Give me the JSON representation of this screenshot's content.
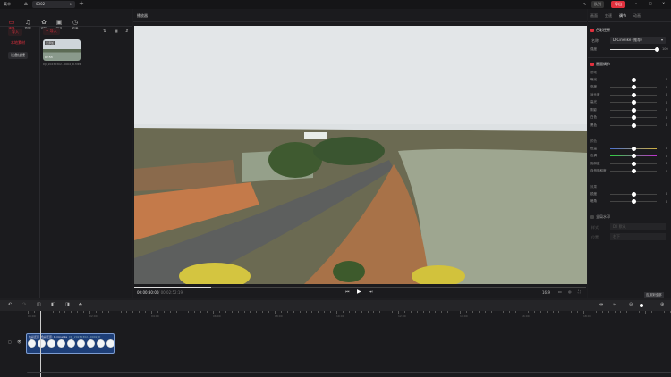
{
  "app": {
    "menu": "菜单",
    "project_tab": "0302",
    "export": "导出",
    "layout": "队列"
  },
  "toolbar": [
    {
      "label": "媒体",
      "icon": "folder-icon",
      "active": true
    },
    {
      "label": "音频",
      "icon": "music-icon"
    },
    {
      "label": "滤镜",
      "icon": "filter-icon"
    },
    {
      "label": "调节",
      "icon": "adjust-icon"
    },
    {
      "label": "效果",
      "icon": "effect-icon"
    }
  ],
  "left": {
    "import": "导入",
    "import_btn": "+ 导入",
    "local": "本地素材",
    "device": "设备连接",
    "media": {
      "badge": "已添加",
      "duration": "02:53",
      "name": "DJI_20230302...0002_D.MP4"
    }
  },
  "player": {
    "title": "播放器",
    "current": "00:00:30:00",
    "total": "/ 00:02:52:19",
    "ratio": "16:9",
    "progress": 0.17
  },
  "right": {
    "tabs": [
      "画面",
      "变速",
      "调节",
      "动画"
    ],
    "active_tab": 2,
    "color": {
      "title": "色彩还原",
      "name_label": "名称",
      "name_value": "D-Cinelike (推荐)",
      "strength_label": "强度",
      "strength": 100
    },
    "adjust": {
      "title": "画面调节",
      "basic_label": "基础",
      "basic": [
        {
          "name": "曝光",
          "v": 0
        },
        {
          "name": "亮度",
          "v": 0
        },
        {
          "name": "对比度",
          "v": 0
        },
        {
          "name": "高光",
          "v": 0
        },
        {
          "name": "阴影",
          "v": 0
        },
        {
          "name": "白色",
          "v": 0
        },
        {
          "name": "黑色",
          "v": 0
        }
      ],
      "color_label": "颜色",
      "colors": [
        {
          "name": "色温",
          "v": 0
        },
        {
          "name": "色调",
          "v": 0
        },
        {
          "name": "饱和度",
          "v": 0
        },
        {
          "name": "自然饱和度",
          "v": 0
        }
      ],
      "effect_label": "效果",
      "effects": [
        {
          "name": "锐度",
          "v": 0
        },
        {
          "name": "暗角",
          "v": 0
        }
      ]
    },
    "watermark": {
      "title": "全局水印",
      "l1": "样式",
      "v1": "DJI 默认",
      "l2": "位置",
      "v2": "右下"
    },
    "apply_all": "应用到全部"
  },
  "timeline": {
    "ticks": [
      "00:00",
      "02:00",
      "04:00",
      "06:00",
      "08:00",
      "10:00",
      "12:00",
      "14:00",
      "16:00",
      "18:00"
    ],
    "clip": {
      "tag1": "色彩还原",
      "tag2": "色彩还原: D-Cinelike",
      "name": "DJI_20230302...0002_D"
    }
  },
  "colors": {
    "accent": "#e0303d",
    "clip": "#1e3f78"
  }
}
